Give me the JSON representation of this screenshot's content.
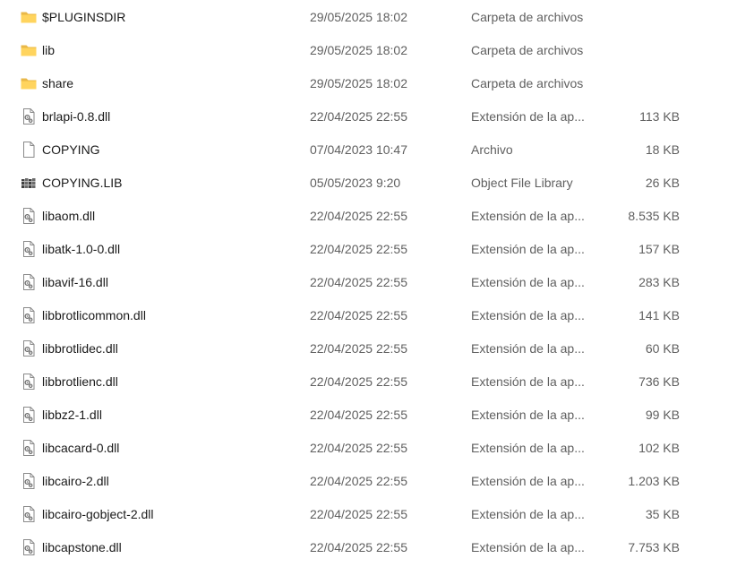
{
  "files": [
    {
      "name": "$PLUGINSDIR",
      "date": "29/05/2025 18:02",
      "type": "Carpeta de archivos",
      "size": "",
      "icon": "folder-icon"
    },
    {
      "name": "lib",
      "date": "29/05/2025 18:02",
      "type": "Carpeta de archivos",
      "size": "",
      "icon": "folder-icon"
    },
    {
      "name": "share",
      "date": "29/05/2025 18:02",
      "type": "Carpeta de archivos",
      "size": "",
      "icon": "folder-icon"
    },
    {
      "name": "brlapi-0.8.dll",
      "date": "22/04/2025 22:55",
      "type": "Extensión de la ap...",
      "size": "113 KB",
      "icon": "dll-file-icon"
    },
    {
      "name": "COPYING",
      "date": "07/04/2023 10:47",
      "type": "Archivo",
      "size": "18 KB",
      "icon": "blank-file-icon"
    },
    {
      "name": "COPYING.LIB",
      "date": "05/05/2023 9:20",
      "type": "Object File Library",
      "size": "26 KB",
      "icon": "library-file-icon"
    },
    {
      "name": "libaom.dll",
      "date": "22/04/2025 22:55",
      "type": "Extensión de la ap...",
      "size": "8.535 KB",
      "icon": "dll-file-icon"
    },
    {
      "name": "libatk-1.0-0.dll",
      "date": "22/04/2025 22:55",
      "type": "Extensión de la ap...",
      "size": "157 KB",
      "icon": "dll-file-icon"
    },
    {
      "name": "libavif-16.dll",
      "date": "22/04/2025 22:55",
      "type": "Extensión de la ap...",
      "size": "283 KB",
      "icon": "dll-file-icon"
    },
    {
      "name": "libbrotlicommon.dll",
      "date": "22/04/2025 22:55",
      "type": "Extensión de la ap...",
      "size": "141 KB",
      "icon": "dll-file-icon"
    },
    {
      "name": "libbrotlidec.dll",
      "date": "22/04/2025 22:55",
      "type": "Extensión de la ap...",
      "size": "60 KB",
      "icon": "dll-file-icon"
    },
    {
      "name": "libbrotlienc.dll",
      "date": "22/04/2025 22:55",
      "type": "Extensión de la ap...",
      "size": "736 KB",
      "icon": "dll-file-icon"
    },
    {
      "name": "libbz2-1.dll",
      "date": "22/04/2025 22:55",
      "type": "Extensión de la ap...",
      "size": "99 KB",
      "icon": "dll-file-icon"
    },
    {
      "name": "libcacard-0.dll",
      "date": "22/04/2025 22:55",
      "type": "Extensión de la ap...",
      "size": "102 KB",
      "icon": "dll-file-icon"
    },
    {
      "name": "libcairo-2.dll",
      "date": "22/04/2025 22:55",
      "type": "Extensión de la ap...",
      "size": "1.203 KB",
      "icon": "dll-file-icon"
    },
    {
      "name": "libcairo-gobject-2.dll",
      "date": "22/04/2025 22:55",
      "type": "Extensión de la ap...",
      "size": "35 KB",
      "icon": "dll-file-icon"
    },
    {
      "name": "libcapstone.dll",
      "date": "22/04/2025 22:55",
      "type": "Extensión de la ap...",
      "size": "7.753 KB",
      "icon": "dll-file-icon"
    }
  ]
}
